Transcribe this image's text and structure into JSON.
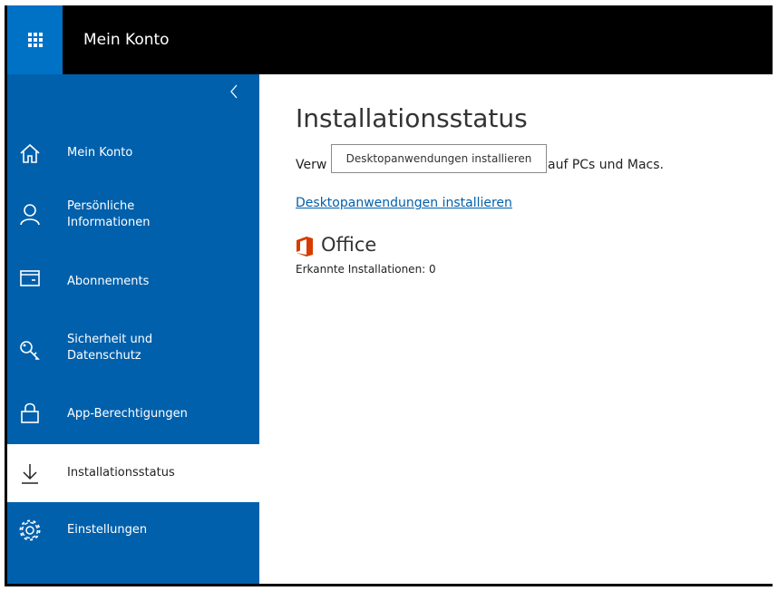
{
  "header": {
    "app_title": "Mein Konto",
    "waffle_icon": "app-launcher-icon"
  },
  "sidebar": {
    "collapse_icon": "chevron-left-icon",
    "items": [
      {
        "label": "Mein Konto",
        "icon": "home-icon"
      },
      {
        "label_line1": "Persönliche",
        "label_line2": "Informationen",
        "icon": "person-icon"
      },
      {
        "label": "Abonnements",
        "icon": "card-icon"
      },
      {
        "label_line1": "Sicherheit und",
        "label_line2": "Datenschutz",
        "icon": "key-icon"
      },
      {
        "label": "App-Berechtigungen",
        "icon": "lock-icon"
      },
      {
        "label": "Installationsstatus",
        "icon": "download-icon",
        "active": true
      },
      {
        "label": "Einstellungen",
        "icon": "gear-icon"
      }
    ]
  },
  "main": {
    "title": "Installationsstatus",
    "description_start": "Verw",
    "description_end": "auf PCs und Macs.",
    "tooltip": "Desktopanwendungen installieren",
    "install_link": "Desktopanwendungen installieren",
    "office": {
      "label": "Office",
      "icon": "office-icon",
      "detected": "Erkannte Installationen: 0"
    }
  },
  "colors": {
    "topbar": "#000000",
    "accent": "#0072c6",
    "sidebar": "#0060ac",
    "office_orange": "#d83b01",
    "link": "#0060ac"
  }
}
